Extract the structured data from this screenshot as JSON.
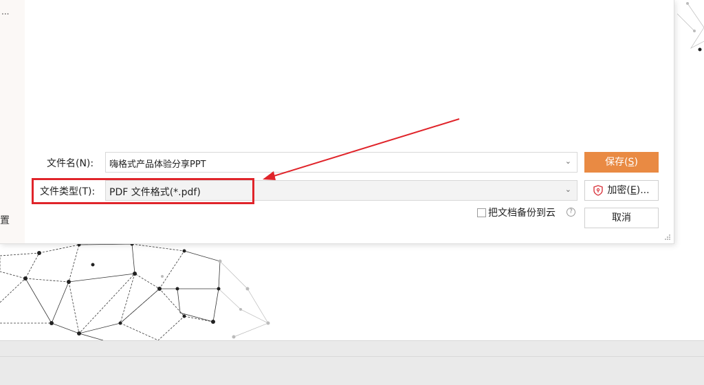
{
  "dialog": {
    "sidebar_ellipsis": "...",
    "sidebar_partial_text": "置",
    "filename_label": "文件名(N):",
    "filename_value": "嗨格式产品体验分享PPT",
    "filetype_label": "文件类型(T):",
    "filetype_value": "PDF 文件格式(*.pdf)",
    "save_button": {
      "text": "保存(",
      "key": "S",
      "suffix": ")"
    },
    "encrypt_button": {
      "text": "加密(",
      "key": "E",
      "suffix": ")..."
    },
    "cancel_button": "取消",
    "cloud_backup_label": "把文档备份到云",
    "cloud_backup_checked": false
  },
  "icons": {
    "dropdown": "chevron-down-icon",
    "shield": "shield-lock-icon",
    "help": "help-circle-icon",
    "arrow": "red-arrow-annotation"
  },
  "colors": {
    "accent": "#e98a43",
    "annotation_red": "#e0242a",
    "taskbar": "#eaeaea"
  }
}
